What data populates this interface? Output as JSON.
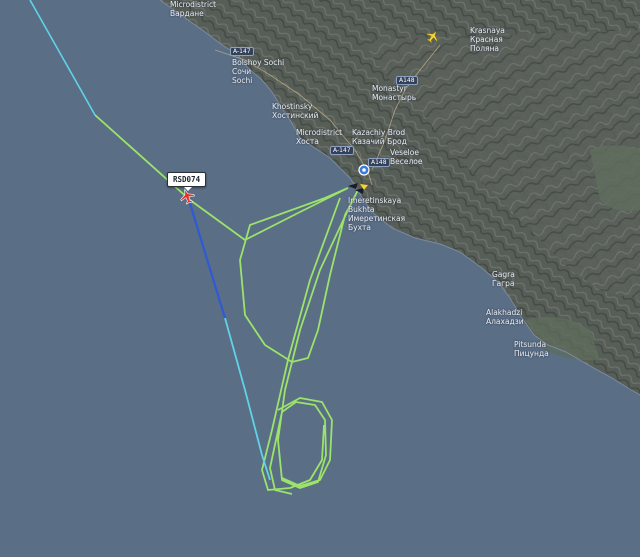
{
  "map": {
    "flight": {
      "callsign": "RSD074",
      "aircraft_icon": "plane-icon",
      "track_colors": {
        "recent": "#9be36a",
        "older_fade": "#5fd3e8",
        "selected_leg": "#2f59d6"
      }
    },
    "other_aircraft_icon": "plane-icon",
    "airport_marker_icon": "map-pin-icon",
    "colors": {
      "sea": "#5a6e86",
      "land": "#555b55",
      "label_text": "#e8ecf2"
    },
    "places": [
      {
        "key": "vardane",
        "lines": [
          "Microdistrict",
          "Вардане"
        ]
      },
      {
        "key": "sochi",
        "lines": [
          "Bolshoy Sochi",
          "Сочи",
          "Sochi"
        ]
      },
      {
        "key": "khostinsky",
        "lines": [
          "Khostinsky",
          "Хостинский"
        ]
      },
      {
        "key": "khosta",
        "lines": [
          "Microdistrict",
          "Хоста"
        ]
      },
      {
        "key": "kazachiy_brod",
        "lines": [
          "Kazachiy Brod",
          "Казачий Брод"
        ]
      },
      {
        "key": "monastyr",
        "lines": [
          "Monastyr",
          "Монастырь"
        ]
      },
      {
        "key": "krasnaya_polyana",
        "lines": [
          "Krasnaya",
          "Красная",
          "Поляна"
        ]
      },
      {
        "key": "veseloye",
        "lines": [
          "Veseloe",
          "Веселое"
        ]
      },
      {
        "key": "bukhta",
        "lines": [
          "Imeretinskaya",
          "Bukhta",
          "Имеретинская",
          "Бухта"
        ]
      },
      {
        "key": "gagra",
        "lines": [
          "Gagra",
          "Гагра"
        ]
      },
      {
        "key": "alakhadzi",
        "lines": [
          "Alakhadzi",
          "Алахадзи"
        ]
      },
      {
        "key": "pitsunda",
        "lines": [
          "Pitsunda",
          "Пицунда"
        ]
      }
    ],
    "roads": [
      "A-147",
      "A-147",
      "A148",
      "A148"
    ]
  }
}
